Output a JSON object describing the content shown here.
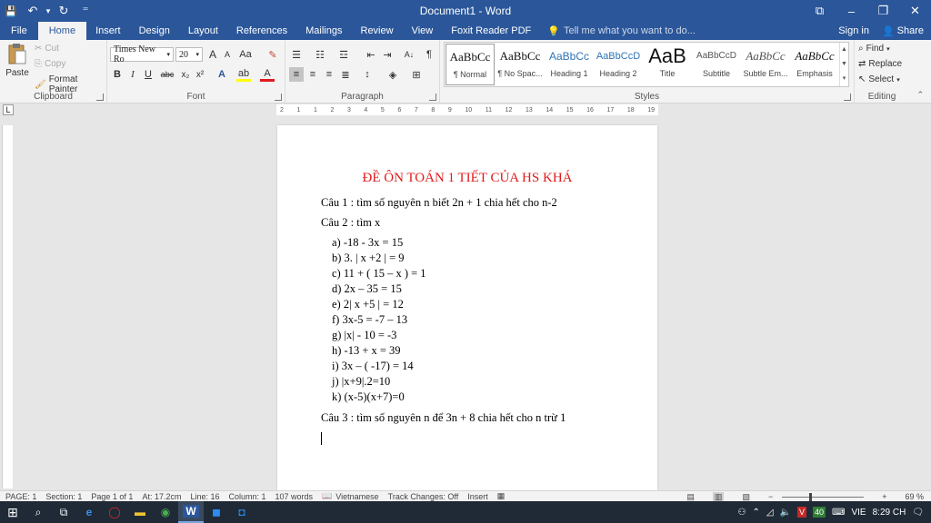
{
  "window": {
    "title": "Document1 - Word",
    "minimize": "–",
    "restore": "❐",
    "close": "✕",
    "options": "⧉"
  },
  "qat": {
    "save": "💾",
    "undo": "↶",
    "undo_dropdown": "▾",
    "redo": "↻",
    "customize": "⁼"
  },
  "tabs": [
    "File",
    "Home",
    "Insert",
    "Design",
    "Layout",
    "References",
    "Mailings",
    "Review",
    "View",
    "Foxit Reader PDF"
  ],
  "active_tab": "Home",
  "tell_me": "Tell me what you want to do...",
  "sign_in": "Sign in",
  "share": "Share",
  "clipboard": {
    "label": "Clipboard",
    "paste": "Paste",
    "cut": "Cut",
    "copy": "Copy",
    "format_painter": "Format Painter"
  },
  "font": {
    "label": "Font",
    "name": "Times New Ro",
    "size": "20",
    "grow": "A",
    "shrink": "A",
    "case": "Aa",
    "bold": "B",
    "italic": "I",
    "underline": "U",
    "strike": "abc",
    "subscript": "x₂",
    "superscript": "x²"
  },
  "paragraph": {
    "label": "Paragraph",
    "pilcrow": "¶"
  },
  "styles": {
    "label": "Styles",
    "items": [
      {
        "preview": "AaBbCc",
        "name": "¶ Normal"
      },
      {
        "preview": "AaBbCc",
        "name": "¶ No Spac..."
      },
      {
        "preview": "AaBbCc",
        "name": "Heading 1"
      },
      {
        "preview": "AaBbCcD",
        "name": "Heading 2"
      },
      {
        "preview": "AaB",
        "name": "Title"
      },
      {
        "preview": "AaBbCcD",
        "name": "Subtitle"
      },
      {
        "preview": "AaBbCc",
        "name": "Subtle Em..."
      },
      {
        "preview": "AaBbCc",
        "name": "Emphasis"
      }
    ]
  },
  "editing": {
    "label": "Editing",
    "find": "Find",
    "replace": "Replace",
    "select": "Select"
  },
  "ruler": {
    "tab_selector": "L",
    "ticks": [
      "2",
      "1",
      "1",
      "2",
      "3",
      "4",
      "5",
      "6",
      "7",
      "8",
      "9",
      "10",
      "11",
      "12",
      "13",
      "14",
      "15",
      "16",
      "17",
      "18",
      "19"
    ]
  },
  "document": {
    "title": "ĐỀ ÔN TOÁN 1 TIẾT CỦA HS KHÁ",
    "q1": "Câu 1 : tìm số nguyên n biết 2n + 1 chia hết cho n-2",
    "q2": "Câu 2 : tìm x",
    "items": [
      "a) -18 - 3x = 15",
      "b) 3. | x +2 | = 9",
      "c) 11 + ( 15 – x ) = 1",
      "d) 2x – 35 = 15",
      "e) 2| x +5 | = 12",
      "f) 3x-5 = -7 – 13",
      "g) |x| - 10 = -3",
      "h) -13 + x = 39",
      "i) 3x – ( -17) = 14",
      "j) |x+9|.2=10",
      "k) (x-5)(x+7)=0"
    ],
    "q3": "Câu 3 : tìm số nguyên n để 3n + 8 chia hết cho n trừ 1"
  },
  "status": {
    "page": "PAGE: 1",
    "section": "Section: 1",
    "page_of": "Page 1 of 1",
    "at": "At: 17.2cm",
    "line": "Line: 16",
    "column": "Column: 1",
    "words": "107 words",
    "language": "Vietnamese",
    "track": "Track Changes: Off",
    "mode": "Insert",
    "zoom": "69 %",
    "zoom_minus": "−",
    "zoom_plus": "+"
  },
  "taskbar": {
    "start": "⊞",
    "search": "⌕",
    "taskview": "⧉",
    "v_badge": "V",
    "num_badge": "40",
    "lang": "VIE",
    "time": "8:29 CH"
  }
}
